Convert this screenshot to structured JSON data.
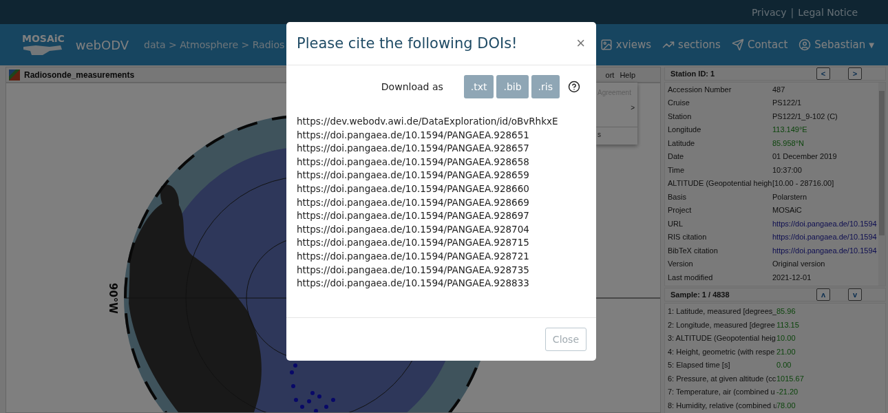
{
  "top_bar": {
    "links": [
      "Privacy",
      "Legal Notice"
    ],
    "separator": "|"
  },
  "nav": {
    "logo": "MOSAiC",
    "app": "webODV",
    "breadcrumb": "data > Atmosphere > Radios",
    "items": [
      {
        "kind": "image",
        "label": "xviews"
      },
      {
        "kind": "chart",
        "label": "sections"
      },
      {
        "kind": "send",
        "label": "Contact"
      },
      {
        "kind": "user",
        "label": "Sebastian",
        "caret": "▼"
      }
    ]
  },
  "map_panel": {
    "title": "Radiosonde_measurements",
    "menu": [
      "ort",
      "Help"
    ],
    "dropdown": [
      {
        "label": "Agreement",
        "disabled": true
      },
      {
        "label": ">",
        "disabled": false
      },
      {
        "label": "s",
        "disabled": false
      }
    ],
    "lon_label": "90°W"
  },
  "station": {
    "title": "Station ID: 1",
    "prev": "<",
    "next": ">",
    "rows": [
      {
        "key": "Accession Number",
        "value": "487",
        "kind": "text"
      },
      {
        "key": "Cruise",
        "value": "PS122/1",
        "kind": "text"
      },
      {
        "key": "Station",
        "value": "PS122/1_9-102 (C)",
        "kind": "text"
      },
      {
        "key": "Longitude",
        "value": "113.149°E",
        "kind": "coord"
      },
      {
        "key": "Latitude",
        "value": "85.958°N",
        "kind": "coord"
      },
      {
        "key": "Date",
        "value": "01 December 2019",
        "kind": "text"
      },
      {
        "key": "Time",
        "value": "10:37:00",
        "kind": "text"
      },
      {
        "key": "ALTITUDE (Geopotential heigh",
        "value": "[10.00 - 28716.00]",
        "kind": "text"
      },
      {
        "key": "Basis",
        "value": "Polarstern",
        "kind": "text"
      },
      {
        "key": "Project",
        "value": "MOSAiC",
        "kind": "text"
      },
      {
        "key": "URL",
        "value": "https://doi.pangaea.de/10.1594",
        "kind": "link"
      },
      {
        "key": "RIS citation",
        "value": "https://doi.pangaea.de/10.1594",
        "kind": "link"
      },
      {
        "key": "BibTeX citation",
        "value": "https://doi.pangaea.de/10.1594",
        "kind": "link"
      },
      {
        "key": "Version",
        "value": "Original version",
        "kind": "text"
      },
      {
        "key": "Last modified",
        "value": "2021-12-01",
        "kind": "text"
      }
    ]
  },
  "sample": {
    "title": "Sample: 1 / 4838",
    "up": "ʌ",
    "down": "v",
    "rows": [
      {
        "key": "1: Latitude, measured [degrees_",
        "value": "85.96"
      },
      {
        "key": "2: Longitude, measured [degree",
        "value": "113.15"
      },
      {
        "key": "3: ALTITUDE (Geopotential heig",
        "value": "10.00"
      },
      {
        "key": "4: Height, geometric (with respe",
        "value": "21.00"
      },
      {
        "key": "5: Elapsed time [s]",
        "value": "0.00"
      },
      {
        "key": "6: Pressure, at given altitude (cc",
        "value": "1015.67"
      },
      {
        "key": "7: Temperature, air (combined u",
        "value": "-21.20"
      },
      {
        "key": "8: Humidity, relative (combined u",
        "value": "78.00"
      }
    ]
  },
  "modal": {
    "title": "Please cite the following DOIs!",
    "close_icon": "×",
    "download_label": "Download as",
    "formats": [
      ".txt",
      ".bib",
      ".ris"
    ],
    "links": [
      "https://dev.webodv.awi.de/DataExploration/id/oBvRhkxE",
      "https://doi.pangaea.de/10.1594/PANGAEA.928651",
      "https://doi.pangaea.de/10.1594/PANGAEA.928657",
      "https://doi.pangaea.de/10.1594/PANGAEA.928658",
      "https://doi.pangaea.de/10.1594/PANGAEA.928659",
      "https://doi.pangaea.de/10.1594/PANGAEA.928660",
      "https://doi.pangaea.de/10.1594/PANGAEA.928669",
      "https://doi.pangaea.de/10.1594/PANGAEA.928697",
      "https://doi.pangaea.de/10.1594/PANGAEA.928704",
      "https://doi.pangaea.de/10.1594/PANGAEA.928715",
      "https://doi.pangaea.de/10.1594/PANGAEA.928721",
      "https://doi.pangaea.de/10.1594/PANGAEA.928735",
      "https://doi.pangaea.de/10.1594/PANGAEA.928833"
    ],
    "close_button": "Close"
  }
}
